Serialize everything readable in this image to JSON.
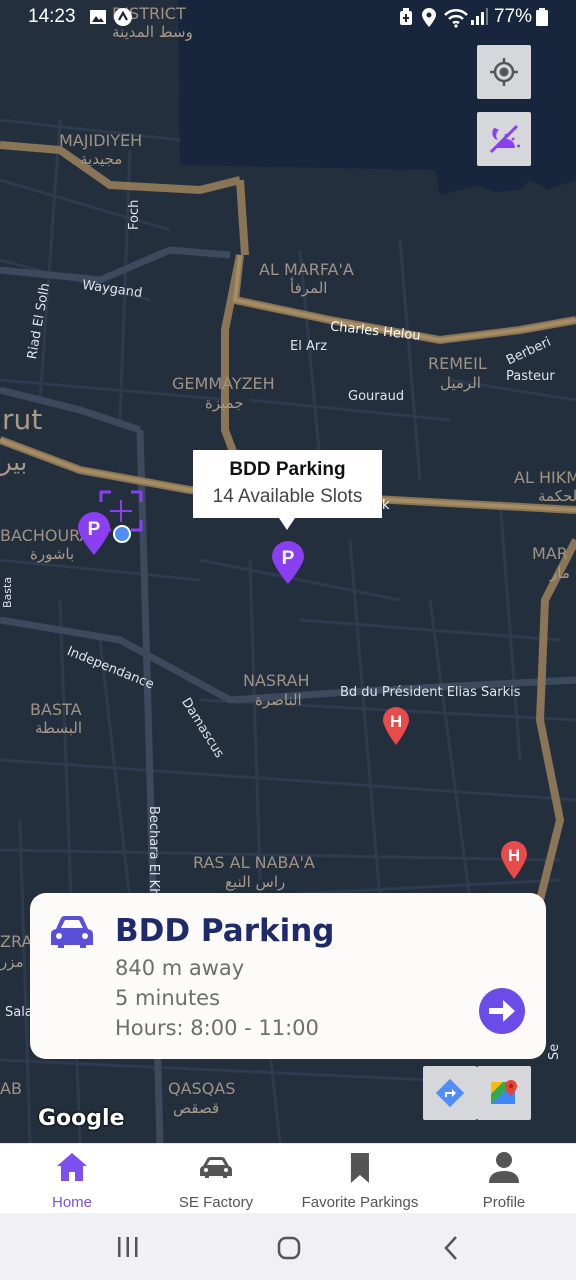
{
  "status_bar": {
    "time": "14:23",
    "battery": "77%"
  },
  "map": {
    "labels": {
      "district_top": "DISTRICT",
      "district_top_ar": "وسط المدينة",
      "majidiyeh": "MAJIDIYEH",
      "majidiyeh_ar": "مجيدية",
      "foch": "Foch",
      "waygand": "Waygand",
      "riad_el_solh": "Riad El Solh",
      "al_marfaa": "AL MARFA'A",
      "al_marfaa_ar": "المرفأ",
      "charles_helou": "Charles Helou",
      "el_arz": "El Arz",
      "remeil": "REMEIL",
      "remeil_ar": "الرميل",
      "berberi": "Berberi",
      "pasteur": "Pasteur",
      "gemmayzeh": "GEMMAYZEH",
      "gemmayzeh_ar": "جميزة",
      "gouraud": "Gouraud",
      "beirut_partial": "rut",
      "beirut_partial_ar": "بير",
      "al_hikma": "AL HIKM",
      "al_hikma_ar": "الحكمة",
      "mar": "MAR",
      "mar_ar": "مار",
      "bachoura": "BACHOURA",
      "bachoura_ar": "باشورة",
      "basta_road": "Basta",
      "independance": "Independance",
      "nasrah": "NASRAH",
      "nasrah_ar": "الناصرة",
      "bd_sarkis": "Bd du Président Elias Sarkis",
      "basta": "BASTA",
      "basta_ar": "البسطة",
      "damascus": "Damascus",
      "bechara": "Bechara El Kh",
      "ras_al_nabaa": "RAS AL NABA'A",
      "ras_al_nabaa_ar": "راس النبع",
      "zra": "ZRA",
      "zra_ar": "مزر",
      "sala": "Sala",
      "ab": "AB",
      "qasqas": "QASQAS",
      "qasqas_ar": "قصقص",
      "k": "k",
      "sea": "Se"
    },
    "callout": {
      "title": "BDD Parking",
      "subtitle": "14 Available Slots"
    },
    "pin_letter": "P",
    "hospital_letter": "H",
    "google_logo": "Google",
    "accent_color": "#8a4ff0"
  },
  "parking_card": {
    "name": "BDD Parking",
    "distance": "840 m  away",
    "duration": "5 minutes",
    "hours": "Hours: 8:00 - 11:00"
  },
  "bottom_nav": {
    "items": [
      {
        "label": "Home",
        "icon": "home-icon",
        "active": true
      },
      {
        "label": "SE Factory",
        "icon": "car-icon",
        "active": false
      },
      {
        "label": "Favorite Parkings",
        "icon": "bookmark-icon",
        "active": false
      },
      {
        "label": "Profile",
        "icon": "person-icon",
        "active": false
      }
    ]
  },
  "colors": {
    "active": "#7b4ff0",
    "card_title": "#1f2a6b",
    "map_bg": "#242f3e"
  }
}
